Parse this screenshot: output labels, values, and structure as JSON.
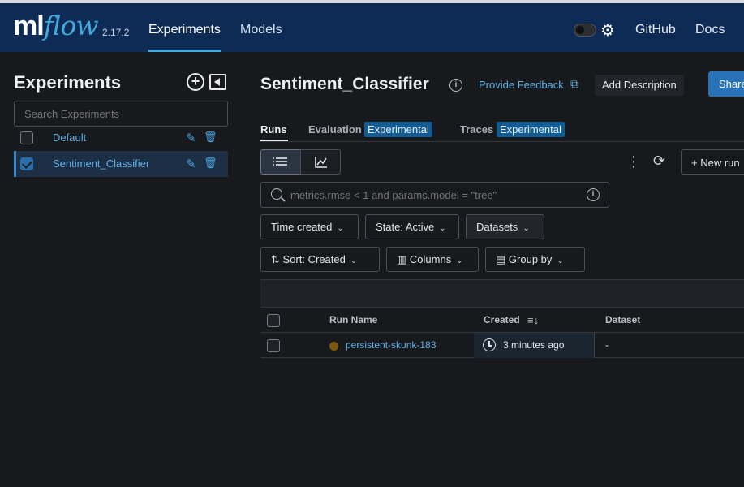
{
  "app": {
    "logo_ml": "ml",
    "logo_flow": "flow",
    "version": "2.17.2",
    "nav": {
      "experiments": "Experiments",
      "models": "Models"
    },
    "links": {
      "github": "GitHub",
      "docs": "Docs"
    },
    "icons": {
      "theme_toggle": "theme-toggle-icon",
      "settings": "gear-icon"
    },
    "colors": {
      "header_bg": "#0e2b56",
      "accent": "#43a8dd",
      "link": "#5db0e8",
      "primary_button": "#2873b8"
    }
  },
  "sidebar": {
    "title": "Experiments",
    "search_placeholder": "Search Experiments",
    "experiments": [
      {
        "name": "Default",
        "checked": false,
        "selected": false
      },
      {
        "name": "Sentiment_Classifier",
        "checked": true,
        "selected": true
      }
    ]
  },
  "header": {
    "title": "Sentiment_Classifier",
    "feedback": "Provide Feedback",
    "add_description": "Add Description",
    "share": "Share"
  },
  "tabs": {
    "runs": "Runs",
    "evaluation": "Evaluation",
    "evaluation_badge": "Experimental",
    "traces": "Traces",
    "traces_badge": "Experimental"
  },
  "toolbar": {
    "new_run": "New run",
    "search_placeholder": "metrics.rmse < 1 and params.model = \"tree\"",
    "filters": {
      "time_created": "Time created",
      "state": "State: Active",
      "datasets": "Datasets"
    },
    "sort": "Sort: Created",
    "columns": "Columns",
    "group_by": "Group by"
  },
  "table": {
    "columns": [
      "Run Name",
      "Created",
      "Dataset"
    ],
    "rows": [
      {
        "run_name": "persistent-skunk-183",
        "created": "3 minutes ago",
        "dataset": "-"
      }
    ]
  }
}
